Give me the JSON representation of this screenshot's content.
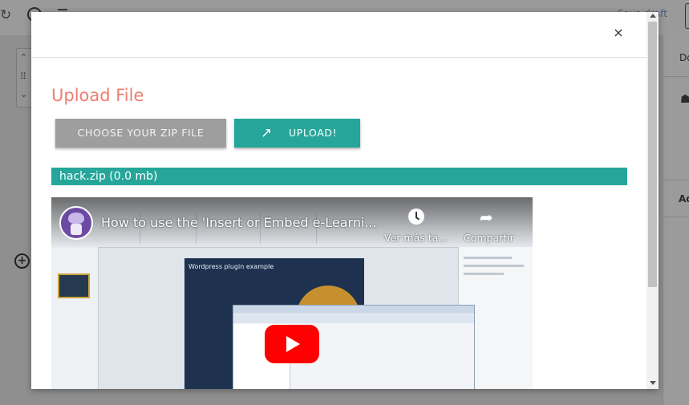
{
  "background": {
    "draft_label": "Save draft",
    "sidebar_tab_1": "Do",
    "sidebar_tab_2": "Ad"
  },
  "modal": {
    "close_label": "×",
    "title": "Upload File",
    "choose_button": "CHOOSE YOUR ZIP FILE",
    "upload_button": "UPLOAD!",
    "upload_icon": "↗",
    "file_info": "hack.zip (0.0 mb)"
  },
  "video": {
    "title": "How to use the 'Insert or Embed e-Learni...",
    "watch_later": "Ver más ta...",
    "share": "Compartir",
    "slide_text": "Wordpress plugin example"
  },
  "colors": {
    "accent_teal": "#26a69a",
    "title_coral": "#ef7d70",
    "choose_gray": "#9e9e9e",
    "youtube_red": "#ff0000"
  }
}
